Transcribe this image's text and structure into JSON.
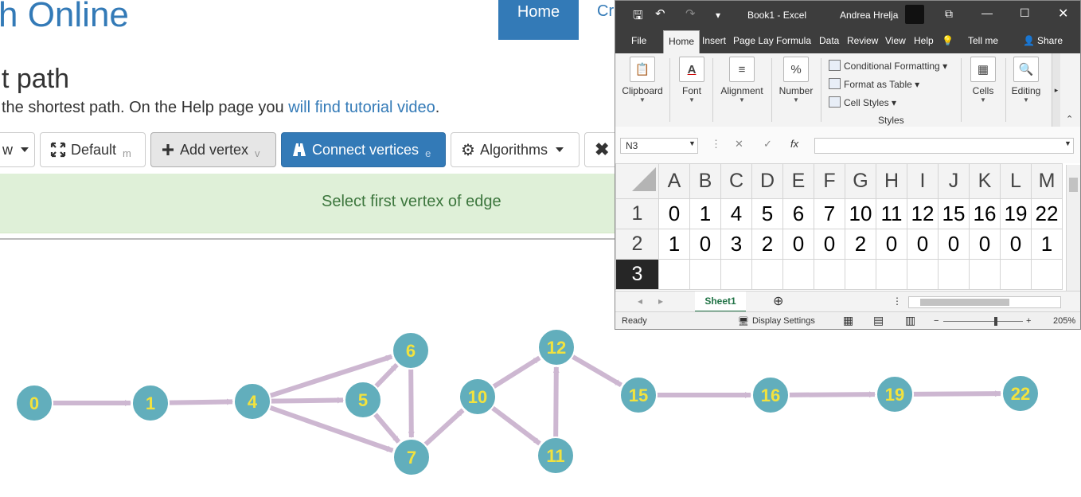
{
  "site": {
    "title": "h Online"
  },
  "nav": {
    "home": "Home",
    "cr": "Cr"
  },
  "page": {
    "heading": "t path",
    "desc_before": "the shortest path. On the Help page you ",
    "desc_link": "will find tutorial video",
    "desc_after": "."
  },
  "toolbar": {
    "view": "w",
    "default": "Default",
    "default_hk": "m",
    "add_vertex": "Add vertex",
    "add_vertex_hk": "v",
    "connect": "Connect vertices",
    "connect_hk": "e",
    "algorithms": "Algorithms"
  },
  "alert": {
    "message": "Select first vertex of edge"
  },
  "graph": {
    "vertices": [
      "0",
      "1",
      "4",
      "5",
      "6",
      "7",
      "10",
      "11",
      "12",
      "15",
      "16",
      "19",
      "22"
    ],
    "colors": {
      "node": "#62aebc",
      "label": "#f2e23e",
      "edge": "#cdb7d1"
    }
  },
  "excel": {
    "title": {
      "book": "Book1 - Excel",
      "user": "Andrea Hrelja"
    },
    "tabs": [
      "File",
      "Home",
      "Insert",
      "Page Lay",
      "Formula",
      "Data",
      "Review",
      "View",
      "Help",
      "Tell me",
      "Share"
    ],
    "ribbon": {
      "clipboard": "Clipboard",
      "font": "Font",
      "alignment": "Alignment",
      "number": "Number",
      "conditional": "Conditional Formatting",
      "format_table": "Format as Table",
      "cell_styles": "Cell Styles",
      "styles": "Styles",
      "cells": "Cells",
      "editing": "Editing"
    },
    "namebox": "N3",
    "fx": "fx",
    "columns": [
      "A",
      "B",
      "C",
      "D",
      "E",
      "F",
      "G",
      "H",
      "I",
      "J",
      "K",
      "L",
      "M"
    ],
    "rows": [
      {
        "num": "1",
        "cells": [
          "0",
          "1",
          "4",
          "5",
          "6",
          "7",
          "10",
          "11",
          "12",
          "15",
          "16",
          "19",
          "22"
        ]
      },
      {
        "num": "2",
        "cells": [
          "1",
          "0",
          "3",
          "2",
          "0",
          "0",
          "2",
          "0",
          "0",
          "0",
          "0",
          "0",
          "1"
        ]
      },
      {
        "num": "3",
        "cells": [
          "",
          "",
          "",
          "",
          "",
          "",
          "",
          "",
          "",
          "",
          "",
          "",
          ""
        ]
      }
    ],
    "sheet": "Sheet1",
    "status": {
      "ready": "Ready",
      "display": "Display Settings",
      "zoom": "205%"
    }
  }
}
